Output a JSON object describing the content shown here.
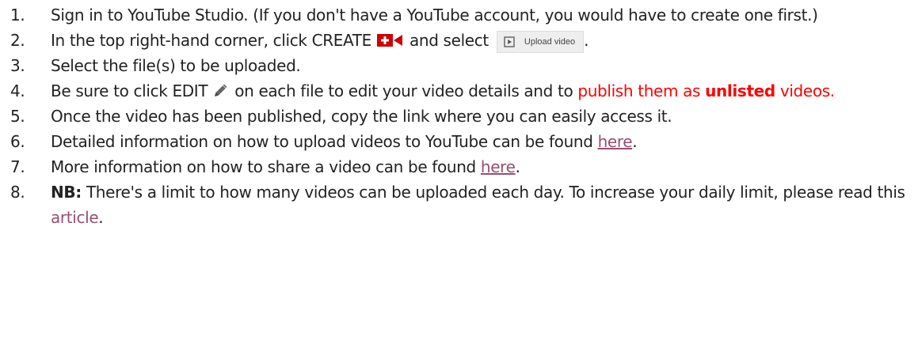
{
  "steps": [
    {
      "num": "1.",
      "text": "Sign in to YouTube Studio. (If you don't have a YouTube account, you would have to create one first.)"
    },
    {
      "num": "2.",
      "before": "In the top right-hand corner, click CREATE ",
      "middle": " and select ",
      "chip_label": "Upload video",
      "after": "."
    },
    {
      "num": "3.",
      "text": "Select the file(s) to be uploaded."
    },
    {
      "num": "4.",
      "before": "Be sure to click EDIT ",
      "middle": " on each file to edit your video details and to ",
      "red_text": "publish them as ",
      "red_bold": "unlisted",
      "red_after": " videos."
    },
    {
      "num": "5.",
      "text": "Once the video has been published, copy the link where you can easily access it."
    },
    {
      "num": "6.",
      "before": "Detailed information on how to upload videos to YouTube can be found ",
      "link": "here",
      "after": "."
    },
    {
      "num": "7.",
      "before": "More information on how to share a video can be found ",
      "link": "here",
      "after": "."
    },
    {
      "num": "8.",
      "bold": "NB:",
      "before": " There's a limit to how many videos can be uploaded each day. To increase your daily limit, please read this ",
      "link": "article",
      "after": "."
    }
  ],
  "colors": {
    "text": "#222222",
    "red": "#ff0000",
    "link": "#954f72",
    "icon_red": "#cc0000",
    "chip_bg": "#eeeeee"
  },
  "icons": [
    "create-video-icon",
    "play-box-icon",
    "pencil-icon"
  ]
}
